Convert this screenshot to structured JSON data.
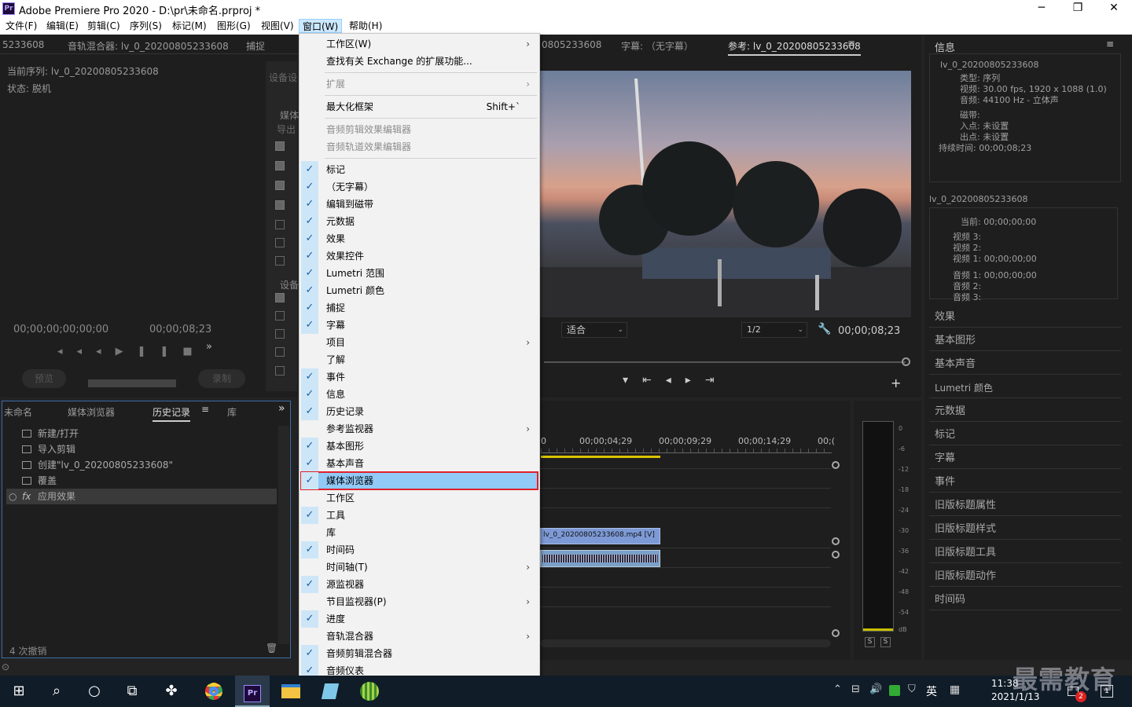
{
  "title": "Adobe Premiere Pro 2020 - D:\\pr\\未命名.prproj *",
  "window_controls": {
    "minimize": "─",
    "maximize": "❐",
    "close": "✕"
  },
  "menubar": [
    "文件(F)",
    "编辑(E)",
    "剪辑(C)",
    "序列(S)",
    "标记(M)",
    "图形(G)",
    "视图(V)",
    "窗口(W)",
    "帮助(H)"
  ],
  "source_panel": {
    "tab_partial": "5233608",
    "tabs": [
      "音轨混合器: lv_0_20200805233608",
      "捕捉"
    ],
    "seq_label": "当前序列: lv_0_20200805233608",
    "status_label": "状态: 脱机",
    "timecode_left": "00;00;00;00;00;00",
    "timecode_right": "00;00;08;23",
    "preview_btn": "预览",
    "record_btn": "录制",
    "settings_partial": "设备设",
    "settings_partial2": "设备",
    "media_partial": "媒体",
    "export_partial": "导出"
  },
  "history_panel": {
    "tabs": [
      "未命名",
      "媒体浏览器",
      "历史记录",
      "库"
    ],
    "items": [
      "新建/打开",
      "导入剪辑",
      "创建\"lv_0_20200805233608\"",
      "覆盖",
      "应用效果"
    ],
    "undo_count": "4 次撤销"
  },
  "program_monitor": {
    "tabs": [
      "0805233608",
      "字幕: （无字幕）",
      "参考: lv_0_20200805233608"
    ],
    "fit": "适合",
    "resolution": "1/2",
    "timecode": "00;00;08;23"
  },
  "timeline": {
    "ticks": [
      "0",
      "00;00;04;29",
      "00;00;09;29",
      "00;00;14;29",
      "00;("
    ],
    "clip_label": "lv_0_20200805233608.mp4 [V]"
  },
  "audio_meter": {
    "scale": [
      "0",
      "-6",
      "-12",
      "-18",
      "-24",
      "-30",
      "-36",
      "-42",
      "-48",
      "-54",
      "dB"
    ],
    "solo": [
      "S",
      "S"
    ]
  },
  "info_panel": {
    "title": "信息",
    "clip_name": "lv_0_20200805233608",
    "type": "类型: 序列",
    "video": "视频: 30.00 fps, 1920 x 1088 (1.0)",
    "audio": "音频: 44100 Hz - 立体声",
    "tape": "磁带:",
    "in_point": "入点: 未设置",
    "out_point": "出点: 未设置",
    "duration": "持续时间: 00;00;08;23",
    "seq_name": "lv_0_20200805233608",
    "current": "当前: 00;00;00;00",
    "v3": "视频 3:",
    "v2": "视频 2:",
    "v1": "视频 1: 00;00;00;00",
    "a1": "音频 1: 00;00;00;00",
    "a2": "音频 2:",
    "a3": "音频 3:"
  },
  "right_list": [
    "效果",
    "基本图形",
    "基本声音",
    "Lumetri 颜色",
    "元数据",
    "标记",
    "字幕",
    "事件",
    "旧版标题属性",
    "旧版标题样式",
    "旧版标题工具",
    "旧版标题动作",
    "时间码"
  ],
  "window_menu": {
    "items": [
      {
        "label": "工作区(W)",
        "check": false,
        "arrow": true
      },
      {
        "label": "查找有关 Exchange 的扩展功能...",
        "check": false
      },
      {
        "label": "扩展",
        "check": false,
        "arrow": true,
        "disabled": true
      },
      {
        "label": "最大化框架",
        "check": false,
        "shortcut": "Shift+`"
      },
      {
        "label": "音频剪辑效果编辑器",
        "check": false,
        "disabled": true
      },
      {
        "label": "音频轨道效果编辑器",
        "check": false,
        "disabled": true
      },
      {
        "label": "标记",
        "check": true
      },
      {
        "label": "（无字幕）",
        "check": true
      },
      {
        "label": "编辑到磁带",
        "check": true
      },
      {
        "label": "元数据",
        "check": true
      },
      {
        "label": "效果",
        "check": true
      },
      {
        "label": "效果控件",
        "check": true
      },
      {
        "label": "Lumetri 范围",
        "check": true
      },
      {
        "label": "Lumetri 颜色",
        "check": true
      },
      {
        "label": "捕捉",
        "check": true
      },
      {
        "label": "字幕",
        "check": true
      },
      {
        "label": "项目",
        "check": false,
        "arrow": true
      },
      {
        "label": "了解",
        "check": false
      },
      {
        "label": "事件",
        "check": true
      },
      {
        "label": "信息",
        "check": true
      },
      {
        "label": "历史记录",
        "check": true
      },
      {
        "label": "参考监视器",
        "check": false,
        "arrow": true
      },
      {
        "label": "基本图形",
        "check": true
      },
      {
        "label": "基本声音",
        "check": true
      },
      {
        "label": "媒体浏览器",
        "check": true,
        "selected": true
      },
      {
        "label": "工作区",
        "check": false
      },
      {
        "label": "工具",
        "check": true
      },
      {
        "label": "库",
        "check": false
      },
      {
        "label": "时间码",
        "check": true
      },
      {
        "label": "时间轴(T)",
        "check": false,
        "arrow": true
      },
      {
        "label": "源监视器",
        "check": true
      },
      {
        "label": "节目监视器(P)",
        "check": false,
        "arrow": true
      },
      {
        "label": "进度",
        "check": true
      },
      {
        "label": "音轨混合器",
        "check": false,
        "arrow": true
      },
      {
        "label": "音频剪辑混合器",
        "check": true
      },
      {
        "label": "音频仪表",
        "check": true
      }
    ]
  },
  "taskbar": {
    "time": "11:38",
    "date": "2021/1/13",
    "ime": "英",
    "badge_count": "2",
    "notif_count": "1",
    "watermark": "最需教育",
    "pr_label": "Pr"
  }
}
